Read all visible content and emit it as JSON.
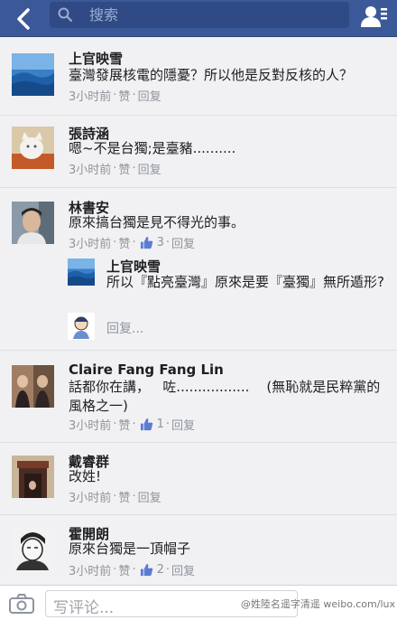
{
  "header": {
    "search_placeholder": "搜索",
    "icons": {
      "back": "chevron-left-icon",
      "search": "search-icon",
      "friends": "friend-requests-icon"
    }
  },
  "comments": [
    {
      "name": "上官映雪",
      "text": "臺灣發展核電的隱憂？所以他是反對反核的人？",
      "time": "3小时前",
      "like": "赞",
      "reply": "回复",
      "likes": ""
    },
    {
      "name": "張詩涵",
      "text": "嗯~不是台獨;是臺豬..........",
      "time": "3小时前",
      "like": "赞",
      "reply": "回复",
      "likes": ""
    },
    {
      "name": "林書安",
      "text": "原來搞台獨是見不得光的事。",
      "time": "3小时前",
      "like": "赞",
      "reply": "回复",
      "likes": "3"
    },
    {
      "name": "Claire Fang Fang Lin",
      "text": "話都你在講，   咗.................    (無恥就是民粹黨的風格之一)",
      "time": "3小时前",
      "like": "赞",
      "reply": "回复",
      "likes": "1"
    },
    {
      "name": "戴睿群",
      "text": "改姓!",
      "time": "3小时前",
      "like": "赞",
      "reply": "回复",
      "likes": ""
    },
    {
      "name": "霍開朗",
      "text": "原來台獨是一頂帽子",
      "time": "3小时前",
      "like": "赞",
      "reply": "回复",
      "likes": "2"
    }
  ],
  "nested_reply": {
    "name": "上官映雪",
    "text": "所以『點亮臺灣』原來是要『臺獨』無所遁形?"
  },
  "reply_box": {
    "placeholder": "回复..."
  },
  "compose": {
    "placeholder": "写评论...",
    "watermark": "@姓陸名遥字清遥 weibo.com/lux"
  },
  "colors": {
    "header_bg": "#3b5998",
    "like_blue": "#5b7bd5"
  }
}
